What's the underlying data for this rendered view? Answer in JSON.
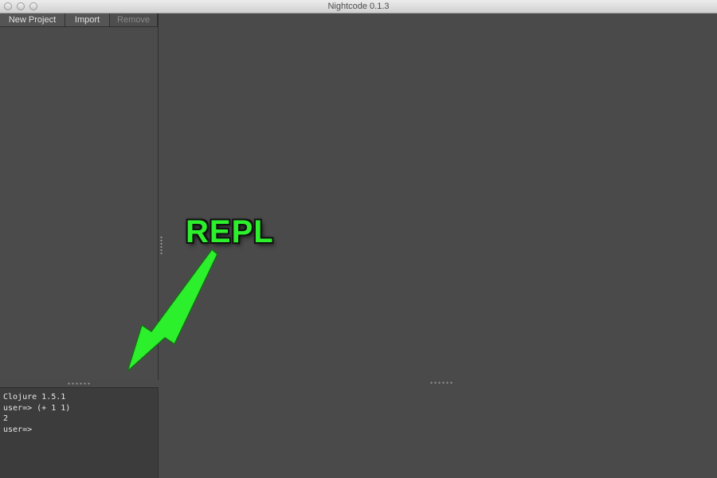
{
  "window": {
    "title": "Nightcode 0.1.3",
    "controls": [
      "close-button",
      "minimize-button",
      "zoom-button"
    ]
  },
  "toolbar": {
    "new_project_label": "New Project",
    "import_label": "Import",
    "remove_label": "Remove"
  },
  "repl": {
    "lines": [
      "Clojure 1.5.1",
      "user=> (+ 1 1)",
      "2",
      "user=>"
    ]
  },
  "annotation": {
    "label": "REPL",
    "color": "#2cf02c"
  },
  "theme": {
    "background": "#4a4a4a",
    "repl_background": "#3c3c3c"
  }
}
